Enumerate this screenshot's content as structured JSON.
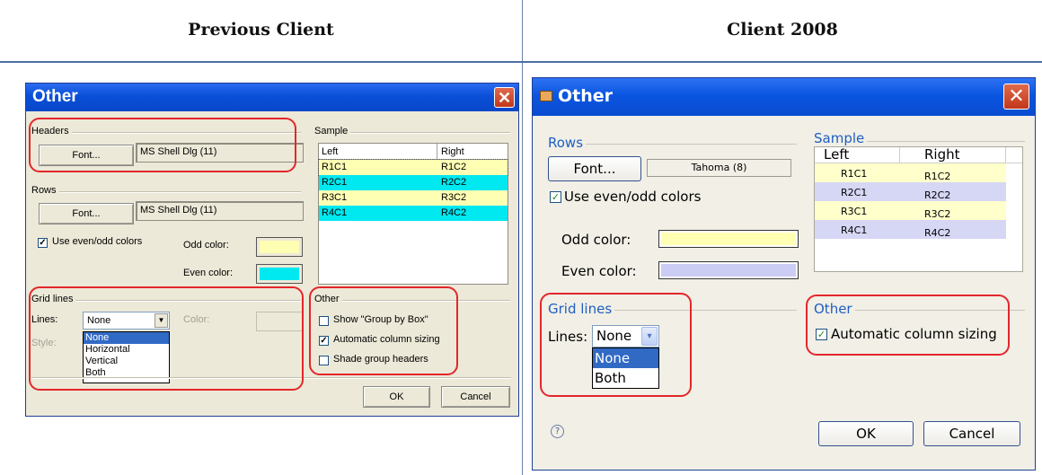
{
  "columns": {
    "left_heading": "Previous Client",
    "right_heading": "Client 2008"
  },
  "old_dialog": {
    "title": "Other",
    "close_glyph": "✕",
    "headers_group": {
      "label": "Headers",
      "font_button": "Font...",
      "font_value": "MS Shell Dlg (11)"
    },
    "rows_group": {
      "label": "Rows",
      "font_button": "Font...",
      "font_value": "MS Shell Dlg (11)",
      "even_odd_label": "Use even/odd colors",
      "even_odd_checked": true,
      "odd_label": "Odd color:",
      "even_label": "Even color:",
      "odd_color": "#ffffb4",
      "even_color": "#00e8f0"
    },
    "grid_lines_group": {
      "label": "Grid lines",
      "lines_label": "Lines:",
      "lines_value": "None",
      "color_label": "Color:",
      "style_label": "Style:",
      "options": [
        "None",
        "Horizontal",
        "Vertical",
        "Both"
      ],
      "selected_option": "None"
    },
    "sample_group": {
      "label": "Sample",
      "col_left": "Left",
      "col_right": "Right",
      "rows": [
        {
          "left": "R1C1",
          "right": "R1C2",
          "color": "#ffffb4"
        },
        {
          "left": "R2C1",
          "right": "R2C2",
          "color": "#00e8f0"
        },
        {
          "left": "R3C1",
          "right": "R3C2",
          "color": "#ffffb4"
        },
        {
          "left": "R4C1",
          "right": "R4C2",
          "color": "#00e8f0"
        }
      ]
    },
    "other_group": {
      "label": "Other",
      "show_group_by_box": "Show \"Group by Box\"",
      "show_group_by_box_checked": false,
      "auto_column_sizing": "Automatic column sizing",
      "auto_column_sizing_checked": true,
      "shade_group_headers": "Shade group headers",
      "shade_group_headers_checked": false
    },
    "ok_button": "OK",
    "cancel_button": "Cancel"
  },
  "new_dialog": {
    "title": "Other",
    "close_glyph": "✕",
    "rows_group": {
      "label": "Rows",
      "font_button": "Font...",
      "font_value": "Tahoma (8)",
      "even_odd_label": "Use even/odd colors",
      "even_odd_checked": true,
      "odd_label": "Odd color:",
      "even_label": "Even color:",
      "odd_color": "#ffffb4",
      "even_color": "#cccdf5"
    },
    "sample_group": {
      "label": "Sample",
      "col_left": "Left",
      "col_right": "Right",
      "rows": [
        {
          "left": "R1C1",
          "right": "R1C2",
          "color": "#ffffcc"
        },
        {
          "left": "R2C1",
          "right": "R2C2",
          "color": "#d6d6f5"
        },
        {
          "left": "R3C1",
          "right": "R3C2",
          "color": "#ffffcc"
        },
        {
          "left": "R4C1",
          "right": "R4C2",
          "color": "#d6d6f5"
        }
      ]
    },
    "grid_lines_group": {
      "label": "Grid lines",
      "lines_label": "Lines:",
      "lines_value": "None",
      "options": [
        "None",
        "Both"
      ],
      "selected_option": "None"
    },
    "other_group": {
      "label": "Other",
      "auto_column_sizing": "Automatic column sizing",
      "auto_column_sizing_checked": true
    },
    "help_glyph": "?",
    "ok_button": "OK",
    "cancel_button": "Cancel"
  },
  "colors": {
    "highlight_outline": "#e4262b",
    "title_bar_blue": "#0a56e0",
    "selection_blue": "#316ac5"
  }
}
